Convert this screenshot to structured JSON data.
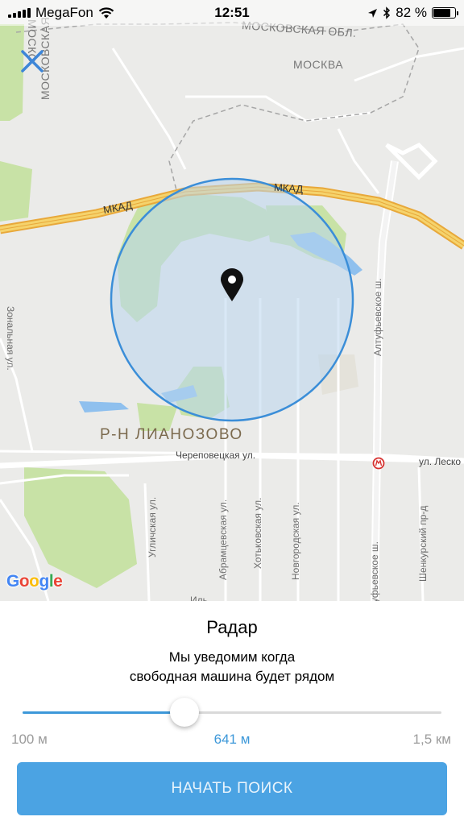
{
  "status_bar": {
    "carrier": "MegaFon",
    "time": "12:51",
    "battery_percent": "82 %",
    "battery_level": 0.82,
    "icons": [
      "signal-icon",
      "wifi-icon",
      "location-arrow-icon",
      "bluetooth-icon",
      "battery-icon"
    ]
  },
  "map": {
    "labels": {
      "mkad_1": "МКАД",
      "mkad_2": "МКАД",
      "moscow": "МОСКВА",
      "moscow_oblast": "МОСКОВСКАЯ ОБЛ.",
      "moscow_oblast_vertical": "МОСКОВСКАЯ",
      "moscow_oblast_vertical_2": "МОСКО",
      "district": "Р-Н ЛИАНОЗОВО",
      "cherepovetskaya": "Череповецкая ул.",
      "leskova": "ул. Леско",
      "zonalnaya": "Зональная ул.",
      "uglichskaya": "Угличская ул.",
      "abramtsevskaya": "Абрамцевская ул.",
      "khotkovskaya": "Хотьковская ул.",
      "novgorodskaya": "Новгородская ул.",
      "altufyevskoe_1": "Алтуфьевское ш.",
      "altufyevskoe_2": "уфьевское ш.",
      "shenkursky": "Шенкурский пр-д",
      "bottom_cut": "Иль"
    },
    "logo": [
      "G",
      "o",
      "o",
      "g",
      "l",
      "e"
    ],
    "icons": [
      "close-icon",
      "map-pin-icon",
      "metro-icon"
    ]
  },
  "panel": {
    "title": "Радар",
    "description_line1": "Мы уведомим когда",
    "description_line2": "свободная машина будет рядом",
    "slider": {
      "min_label": "100 м",
      "max_label": "1,5 км",
      "value_label": "641 м",
      "value": 641,
      "min": 100,
      "max": 1500
    },
    "start_button": "НАЧАТЬ ПОИСК"
  },
  "colors": {
    "accent": "#3d98d9",
    "button": "#4ba3e3",
    "radius_fill": "#cfe2f0",
    "radius_stroke": "#3b8ed8",
    "ring_road": "#f2c94c",
    "park": "#c8e2a6",
    "water": "#8fc0ee"
  }
}
